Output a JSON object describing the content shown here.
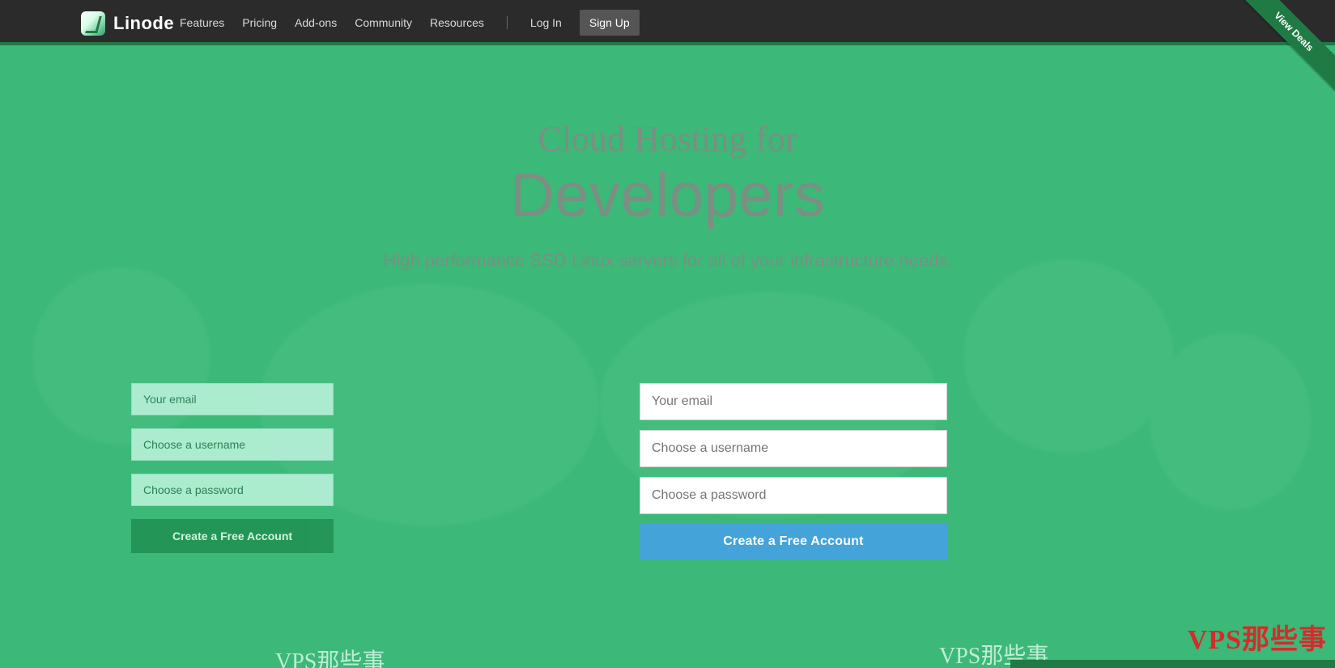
{
  "nav": {
    "brand": "Linode",
    "links": [
      "Features",
      "Pricing",
      "Add-ons",
      "Community",
      "Resources"
    ],
    "login": "Log In",
    "signup": "Sign Up"
  },
  "ribbon": "View Deals",
  "hero": {
    "title_line1": "Cloud Hosting for",
    "title_line2": "Developers",
    "subtitle": "High performance SSD Linux servers for all of your infrastructure needs."
  },
  "form": {
    "email_placeholder": "Your email",
    "username_placeholder": "Choose a username",
    "password_placeholder": "Choose a password",
    "cta": "Create a Free Account"
  },
  "ghost_form": {
    "email_placeholder": "Your email",
    "username_placeholder": "Choose a username",
    "password_placeholder": "Choose a password",
    "cta": "Create a Free Account"
  },
  "watermarks": {
    "left_chinese": "VPS那些事",
    "center_chinese": "VPS那些事",
    "right_brand": "VPS那些事"
  }
}
